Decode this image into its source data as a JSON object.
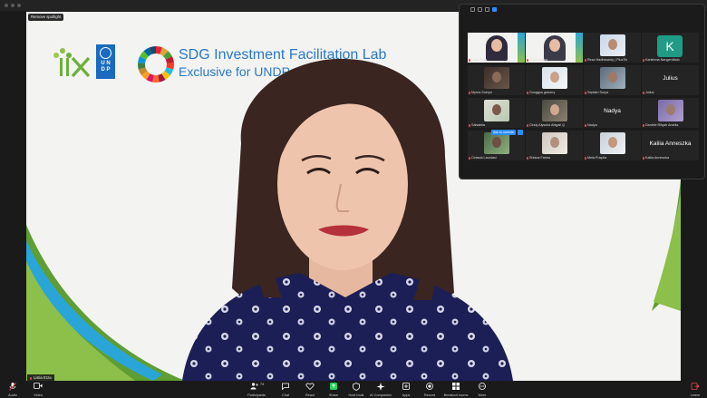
{
  "window": {
    "spotlight_button": "Remove spotlight",
    "speaker_name": "Listia Erza"
  },
  "slide": {
    "title_line1": "SDG Investment Facilitation Lab",
    "title_line2": "Exclusive for UNDP",
    "undp_letters": "U N\nD P"
  },
  "gallery": {
    "unmute_prompt": "Ask to unmute",
    "tiles": [
      {
        "name": "Listia Erza",
        "kind": "slide"
      },
      {
        "name": "Arsul vadika",
        "kind": "slide"
      },
      {
        "name": "Reza Hadhiwardy | PlusTik",
        "kind": "photo"
      },
      {
        "name": "Karishma Nangerdibdo",
        "kind": "letter",
        "letter": "K"
      },
      {
        "name": "Myrna Soeryo",
        "kind": "photo"
      },
      {
        "name": "Gunggus gracery",
        "kind": "photo"
      },
      {
        "name": "Septian Surya",
        "kind": "photo"
      },
      {
        "name": "Julius",
        "kind": "name",
        "big": "Julius"
      },
      {
        "name": "Salsabila",
        "kind": "photo"
      },
      {
        "name": "Cindy Alyssha Abigail Q",
        "kind": "photo"
      },
      {
        "name": "Nadya",
        "kind": "name",
        "big": "Nadya"
      },
      {
        "name": "Daniele Rifqah Amelia",
        "kind": "photo"
      },
      {
        "name": "Octavia Laurdasi",
        "kind": "photo"
      },
      {
        "name": "Shiana Fatma",
        "kind": "photo"
      },
      {
        "name": "Mela Puspita",
        "kind": "photo"
      },
      {
        "name": "Kaliia Anneszka",
        "kind": "name",
        "big": "Kaliia Anneszka"
      }
    ]
  },
  "controls": {
    "audio": "Audio",
    "video": "Video",
    "participants": "Participants",
    "participants_count": "73",
    "chat": "Chat",
    "react": "React",
    "share": "Share",
    "host_tools": "Host tools",
    "ai_companion": "AI Companion",
    "apps": "Apps",
    "record": "Record",
    "breakout": "Breakout rooms",
    "more": "More",
    "leave": "Leave"
  },
  "colors": {
    "accent": "#2d8cff",
    "mute": "#e04848",
    "slide_text": "#2878c8",
    "share_green": "#23d160"
  }
}
